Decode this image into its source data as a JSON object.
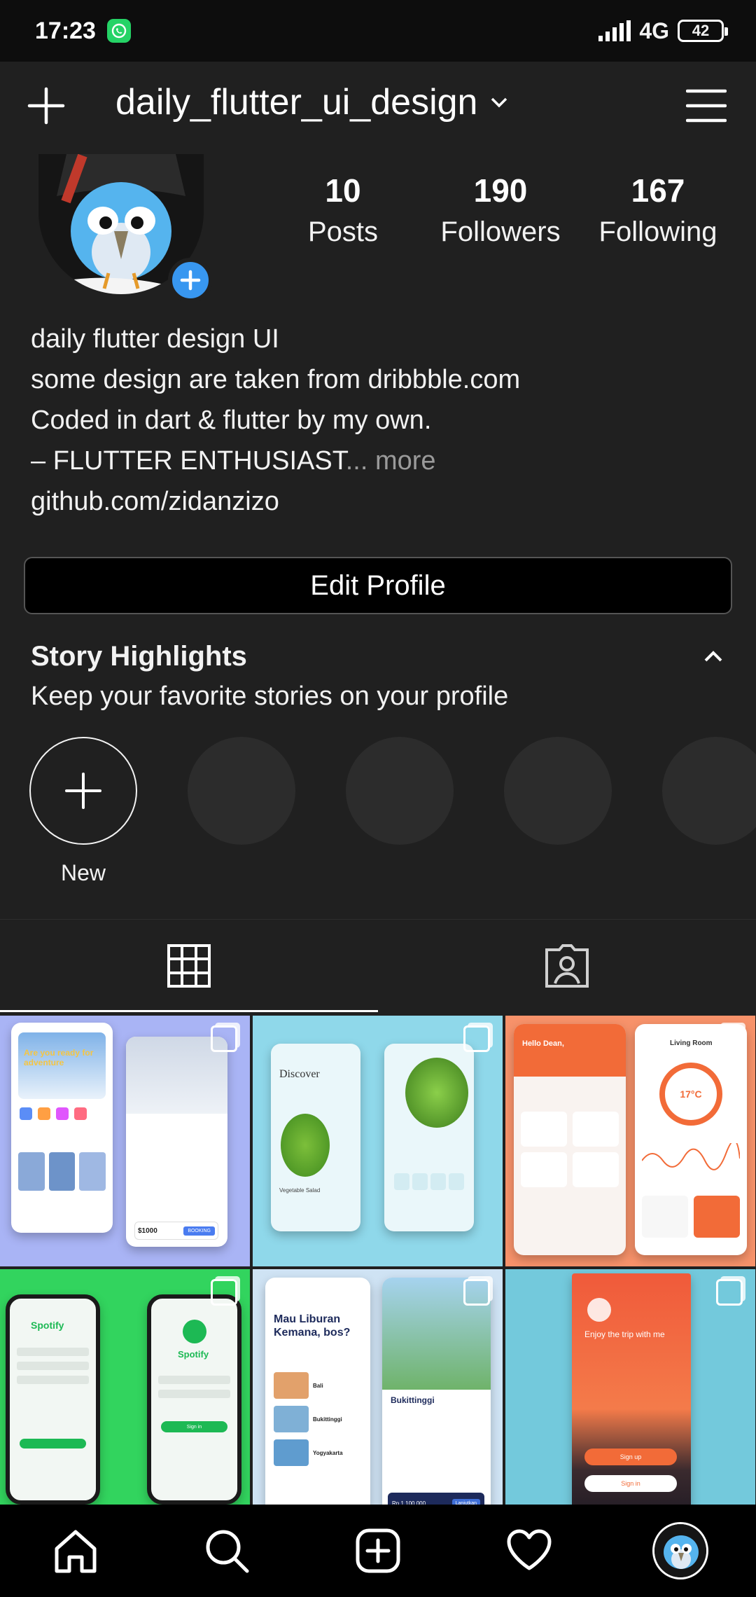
{
  "status_bar": {
    "time": "17:23",
    "network": "4G",
    "battery": "42"
  },
  "header": {
    "username": "daily_flutter_ui_design"
  },
  "stats": [
    {
      "value": "10",
      "label": "Posts"
    },
    {
      "value": "190",
      "label": "Followers"
    },
    {
      "value": "167",
      "label": "Following"
    }
  ],
  "bio": {
    "name": "daily flutter design UI",
    "line1": "some design are taken from dribbble.com",
    "line2": "Coded in dart & flutter by my own.",
    "line3": "– FLUTTER ENTHUSIAST",
    "more": "... more",
    "link": "github.com/zidanzizo"
  },
  "edit_profile_label": "Edit Profile",
  "highlights": {
    "title": "Story Highlights",
    "subtitle": "Keep your favorite stories on your profile",
    "new_label": "New"
  },
  "posts": [
    {
      "title": "Are you ready for adventure",
      "price": "$1000",
      "button": "BOOKING",
      "color": "#a9b4f5"
    },
    {
      "title": "Discover",
      "dish": "Vegetable Salad",
      "color": "#8fd8ea"
    },
    {
      "title": "Hello Dean,",
      "room": "Living Room",
      "temp": "17°C",
      "color": "#f7926a"
    },
    {
      "title": "Spotify",
      "button": "Sign in",
      "color": "#32d45e"
    },
    {
      "title": "Mau Liburan Kemana, bos?",
      "place": "Bukittinggi",
      "price": "Rp 1.100.000",
      "button": "Lanjutkan",
      "places": [
        "Bali",
        "Bukittinggi",
        "Yogyakarta"
      ],
      "color": "#cfe3f4"
    },
    {
      "title": "Enjoy the trip with me",
      "button1": "Sign up",
      "button2": "Sign in",
      "color": "#73c9dc"
    }
  ]
}
